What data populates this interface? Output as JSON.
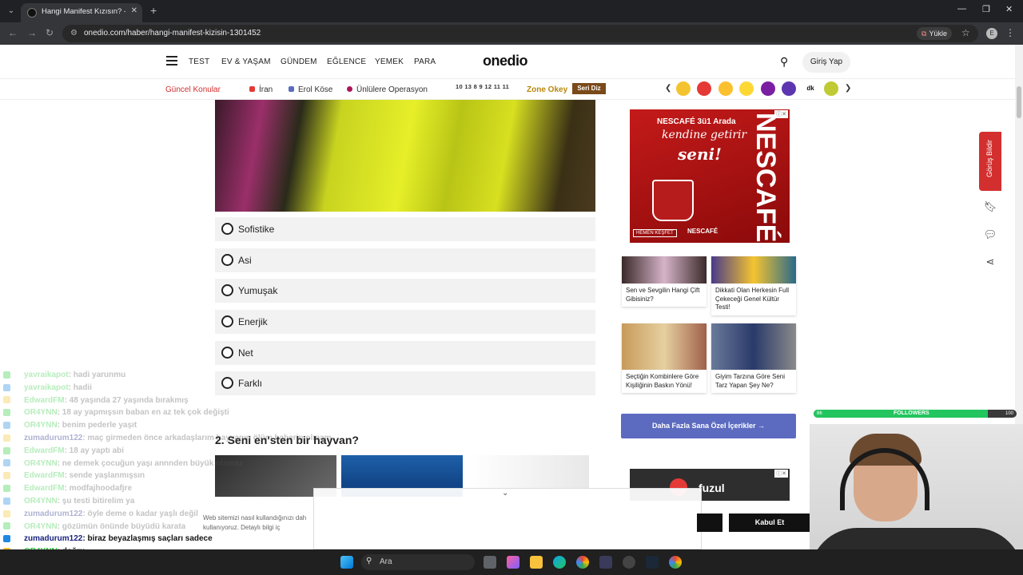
{
  "browser": {
    "tab_title": "Hangi Manifest Kızısın? - Onedio",
    "url": "onedio.com/haber/hangi-manifest-kizisin-1301452",
    "install_label": "Yükle",
    "profile_initial": "E"
  },
  "header": {
    "nav": [
      "TEST",
      "EV & YAŞAM",
      "GÜNDEM",
      "EĞLENCE",
      "YEMEK",
      "PARA"
    ],
    "logo": "onedio",
    "login": "Giriş Yap"
  },
  "topics": {
    "label": "Güncel Konular",
    "items": [
      "İran",
      "Erol Köse",
      "Ünlülere Operasyon"
    ],
    "tiles": "10 13 8 9 12 11 11",
    "zone": "Zone Okey",
    "seri": "Seri Diz"
  },
  "quiz": {
    "options": [
      "Sofistike",
      "Asi",
      "Yumuşak",
      "Enerjik",
      "Net",
      "Farklı"
    ],
    "next_question": "2. Seni en'sten bir hayvan?"
  },
  "sidebar": {
    "nescafe_ad": {
      "line1": "NESCAFÉ 3ü1 Arada",
      "line2": "kendine getirir",
      "line3": "seni!",
      "vertical": "NESCAFÉ",
      "cta": "HEMEN KEŞFET",
      "brand": "NESCAFÉ"
    },
    "cards": [
      {
        "title": "Sen ve Sevgilin Hangi Çift Gibisiniz?"
      },
      {
        "title": "Dikkati Olan Herkesin Full Çekeceği Genel Kültür Testi!"
      },
      {
        "title": "Seçtiğin Kombinlere Göre Kişiliğinin Baskın Yönü!"
      },
      {
        "title": "Giyim Tarzına Göre Seni Tarz Yapan Şey Ne?"
      }
    ],
    "more_button": "Daha Fazla Sana Özel İçerikler →",
    "fuzul_ad": "fuzul"
  },
  "floating": {
    "feedback": "Görüş Bildir"
  },
  "cookie": {
    "text_line1": "Web sitemizi nasıl kullandığınızı dah",
    "text_line2": "kullanıyoruz. Detaylı bilgi iç",
    "accept": "Kabul Et"
  },
  "chat": [
    {
      "user": "yavraikapot",
      "msg": ": hadi yarunmu",
      "faded": true
    },
    {
      "user": "yavraikapot",
      "msg": ": hadii",
      "faded": true
    },
    {
      "user": "EdwardFM",
      "msg": ": 48 yaşında 27 yaşında bırakmış",
      "faded": true
    },
    {
      "user": "OR4YNN",
      "msg": ": 18 ay yapmışsın baban en az tek çok değişti",
      "faded": true
    },
    {
      "user": "OR4YNN",
      "msg": ": benim pederle yaşıt",
      "faded": true
    },
    {
      "user": "zumadurum122",
      "msg": ": maç girmeden önce arkadaşlarım hayvanın ölüm haberin olmam",
      "faded": true,
      "blue": true
    },
    {
      "user": "EdwardFM",
      "msg": ": 18 ay yaptı abi",
      "faded": true
    },
    {
      "user": "OR4YNN",
      "msg": ": ne demek çocuğun yaşı annnden büyük olamaz",
      "faded": true
    },
    {
      "user": "EdwardFM",
      "msg": ": sende yaşlanmışsın",
      "faded": true
    },
    {
      "user": "EdwardFM",
      "msg": ": modfajhoodafjre",
      "faded": true
    },
    {
      "user": "OR4YNN",
      "msg": ": şu testi bitirelim ya",
      "faded": true
    },
    {
      "user": "zumadurum122",
      "msg": ": öyle deme o kadar yaşlı değil",
      "faded": true,
      "blue": true
    },
    {
      "user": "OR4YNN",
      "msg": ": gözümün önünde büyüdü karata",
      "faded": true
    },
    {
      "user": "zumadurum122",
      "msg": ": biraz beyazlaşmış saçları sadece",
      "faded": false,
      "blue": true
    },
    {
      "user": "OR4YNN",
      "msg": ": doğru",
      "faded": false
    }
  ],
  "followers": {
    "label": "FOLLOWERS",
    "current": "86",
    "goal": "100",
    "progress": 0.86
  },
  "taskbar": {
    "search": "Ara"
  },
  "colors": {
    "accent_red": "#d32f2f",
    "more_button": "#5c6bc0",
    "chat_green": "#2ecc40"
  }
}
